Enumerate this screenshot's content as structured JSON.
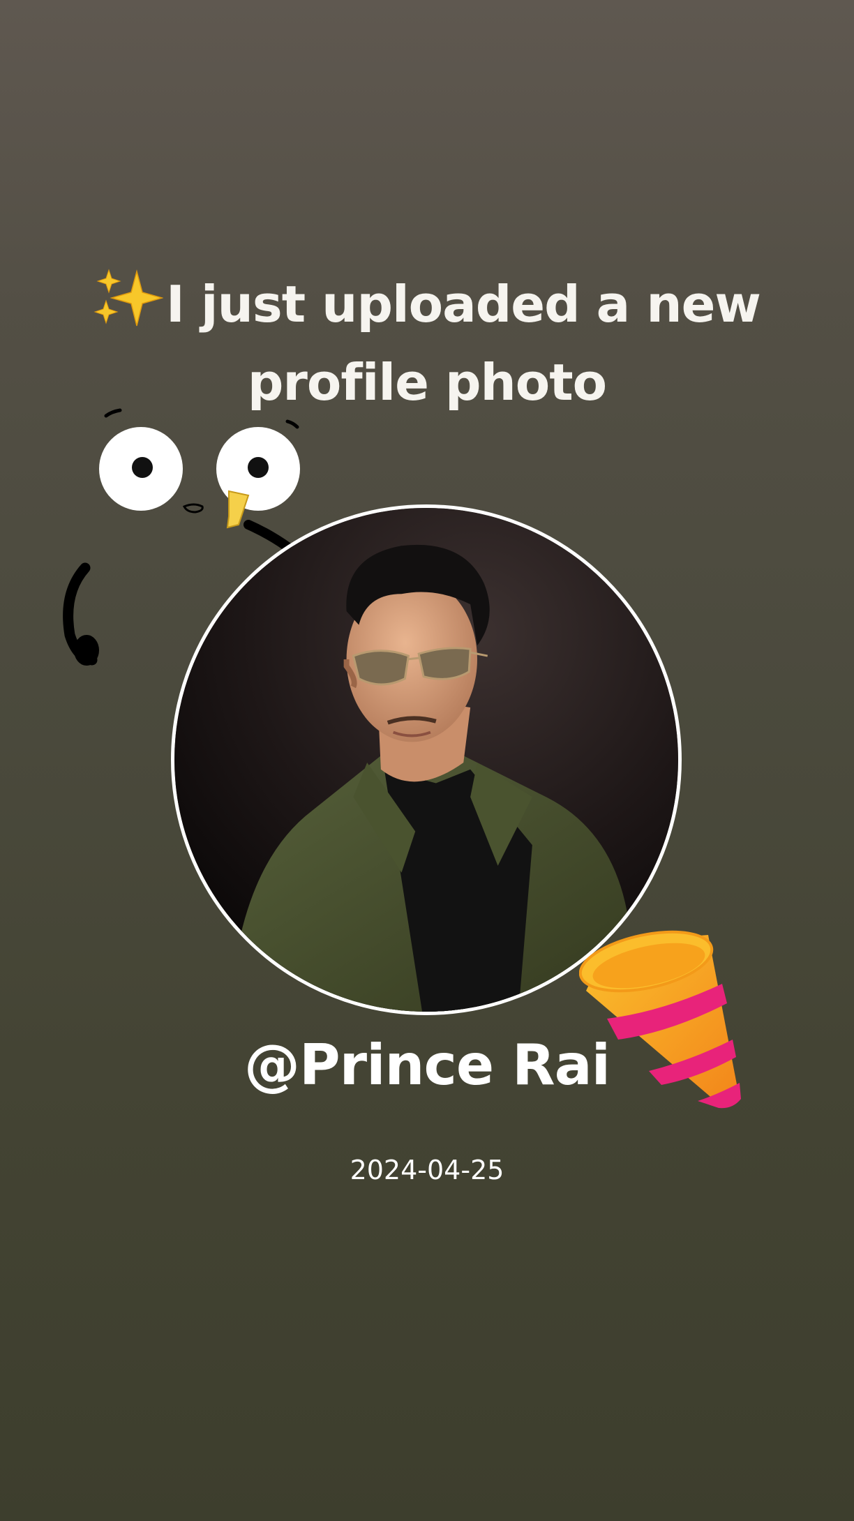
{
  "post": {
    "headline": "I just uploaded a new profile photo",
    "headline_icon": "sparkles-icon",
    "username": "@Prince Rai",
    "date": "2024-04-25"
  },
  "stickers": [
    "sparkles-icon",
    "googly-eyes-face-icon",
    "party-popper-icon"
  ],
  "colors": {
    "background_top": "#5f5850",
    "background_bottom": "#3d3e2d",
    "text": "#ffffff",
    "ring": "#ffffff",
    "sparkle": "#f7c72a",
    "popper_orange": "#f7a21c",
    "popper_pink": "#e8237a"
  }
}
